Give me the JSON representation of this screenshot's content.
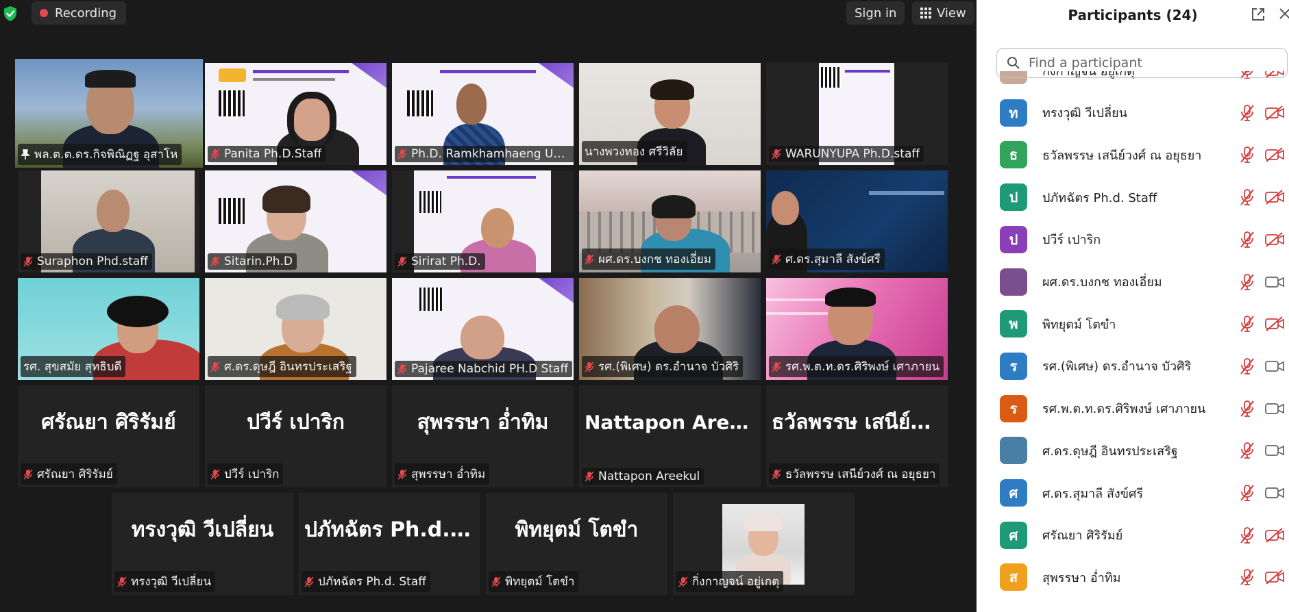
{
  "topbar": {
    "recording_label": "Recording",
    "signin_label": "Sign in",
    "view_label": "View"
  },
  "tiles": [
    {
      "name": "พล.ต.ต.ดร.กิจพิณิฏฐ อุสาโห",
      "pinned": true
    },
    {
      "name": "Panita Ph.D.Staff"
    },
    {
      "name": "Ph.D. Ramkhamhaeng Un..."
    },
    {
      "name": "นางพวงทอง ศรีวิลัย"
    },
    {
      "name": "WARUNYUPA Ph.D.staff"
    },
    {
      "name": "Suraphon Phd.staff"
    },
    {
      "name": "Sitarin.Ph.D"
    },
    {
      "name": "Sirirat Ph.D."
    },
    {
      "name": "ผศ.ดร.บงกช ทองเอี่ยม"
    },
    {
      "name": "ศ.ดร.สุมาลี สังข์ศรี"
    },
    {
      "name": "รศ. สุขสมัย สุทธิบดี"
    },
    {
      "name": "ศ.ดร.ดุษฎี อินทรประเสริฐ"
    },
    {
      "name": "Pajaree Nabchid PH.D Staff"
    },
    {
      "name": "รศ.(พิเศษ) ดร.อำนาจ บัวศิริ"
    },
    {
      "name": "รศ.พ.ต.ท.ดร.ศิริพงษ์ เศาภายน"
    },
    {
      "name": "ศรัณยา ศิริรัมย์",
      "display": "ศรัณยา ศิริรัมย์"
    },
    {
      "name": "ปวีร์ เปาริก",
      "display": "ปวีร์ เปาริก"
    },
    {
      "name": "สุพรรษา อ่ำทิม",
      "display": "สุพรรษา อ่ำทิม"
    },
    {
      "name": "Nattapon Areekul",
      "display": "Nattapon Areekul"
    },
    {
      "name": "ธวัลพรรษ เสนีย์วงศ์ ณ อยุธยา",
      "display": "ธวัลพรรษ เสนีย์ว..."
    },
    {
      "name": "ทรงวุฒิ วีเปลี่ยน",
      "display": "ทรงวุฒิ วีเปลี่ยน"
    },
    {
      "name": "ปภัทฉัตร Ph.d. Staff",
      "display": "ปภัทฉัตร Ph.d. S..."
    },
    {
      "name": "พิทยุตม์ โตขำ",
      "display": "พิทยุตม์ โตขำ"
    },
    {
      "name": "กิ่งกาญจน์ อยู่เกตุ"
    }
  ],
  "panel": {
    "title": "Participants (24)",
    "search_placeholder": "Find a participant",
    "participants": [
      {
        "name": "กิ่งกาญจน์ อยู่เกตุ",
        "initial": "",
        "color": "#c9a89a",
        "mic": "muted",
        "cam": "off"
      },
      {
        "name": "ทรงวุฒิ วีเปลี่ยน",
        "initial": "ท",
        "color": "#2d7cc4",
        "mic": "muted",
        "cam": "off"
      },
      {
        "name": "ธวัลพรรษ เสนีย์วงศ์ ณ อยุธยา",
        "initial": "ธ",
        "color": "#2fa45a",
        "mic": "muted",
        "cam": "off"
      },
      {
        "name": "ปภัทฉัตร Ph.d. Staff",
        "initial": "ป",
        "color": "#1f9a77",
        "mic": "muted",
        "cam": "off"
      },
      {
        "name": "ปวีร์ เปาริก",
        "initial": "ป",
        "color": "#8a3fb8",
        "mic": "muted",
        "cam": "off"
      },
      {
        "name": "ผศ.ดร.บงกช ทองเอี่ยม",
        "initial": "",
        "color": "#7a4f8f",
        "mic": "muted",
        "cam": "on"
      },
      {
        "name": "พิทยุตม์ โตขำ",
        "initial": "พ",
        "color": "#1f9a77",
        "mic": "muted",
        "cam": "off"
      },
      {
        "name": "รศ.(พิเศษ) ดร.อำนาจ บัวศิริ",
        "initial": "ร",
        "color": "#2d7cc4",
        "mic": "muted",
        "cam": "on"
      },
      {
        "name": "รศ.พ.ต.ท.ดร.ศิริพงษ์ เศาภายน",
        "initial": "ร",
        "color": "#d95b14",
        "mic": "muted",
        "cam": "on"
      },
      {
        "name": "ศ.ดร.ดุษฎี อินทรประเสริฐ",
        "initial": "",
        "color": "#4a7fa5",
        "mic": "muted",
        "cam": "on"
      },
      {
        "name": "ศ.ดร.สุมาลี สังข์ศรี",
        "initial": "ศ",
        "color": "#2d7cc4",
        "mic": "muted",
        "cam": "on"
      },
      {
        "name": "ศรัณยา ศิริรัมย์",
        "initial": "ศ",
        "color": "#1f9a77",
        "mic": "muted",
        "cam": "off"
      },
      {
        "name": "สุพรรษา อ่ำทิม",
        "initial": "ส",
        "color": "#f0a01c",
        "mic": "muted",
        "cam": "off"
      }
    ]
  }
}
